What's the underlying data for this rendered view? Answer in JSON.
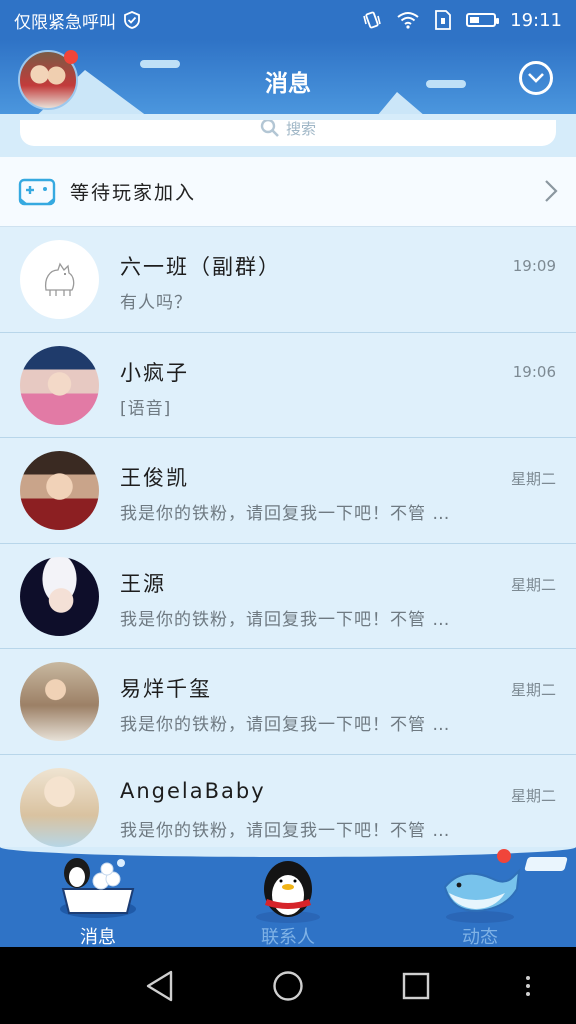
{
  "status_bar": {
    "carrier_text": "仅限紧急呼叫",
    "time": "19:11"
  },
  "header": {
    "title": "消息"
  },
  "search": {
    "placeholder": "搜索"
  },
  "game_row": {
    "label": "等待玩家加入"
  },
  "chats": [
    {
      "name": "六一班（副群）",
      "time": "19:09",
      "preview": "有人吗？",
      "avatar": "cat"
    },
    {
      "name": "小疯子",
      "time": "19:06",
      "preview": "[语音]",
      "avatar": "girl-hat"
    },
    {
      "name": "王俊凯",
      "time": "星期二",
      "preview": "我是你的铁粉，请回复我一下吧！不管 …",
      "avatar": "boy-red"
    },
    {
      "name": "王源",
      "time": "星期二",
      "preview": "我是你的铁粉，请回复我一下吧！不管 …",
      "avatar": "boy-white-hat"
    },
    {
      "name": "易烊千玺",
      "time": "星期二",
      "preview": "我是你的铁粉，请回复我一下吧！不管 …",
      "avatar": "boy-book"
    },
    {
      "name": "AngelaBaby",
      "time": "星期二",
      "preview": "我是你的铁粉，请回复我一下吧！不管 …",
      "avatar": "girl-face"
    }
  ],
  "tabs": [
    {
      "label": "消息",
      "active": true,
      "icon": "penguin-bath-icon"
    },
    {
      "label": "联系人",
      "active": false,
      "icon": "penguin-icon"
    },
    {
      "label": "动态",
      "active": false,
      "icon": "whale-icon"
    }
  ],
  "colors": {
    "accent": "#2f73c6",
    "list_bg": "#dff0fb",
    "badge": "#f0453a",
    "tab_active": "#ffffff",
    "tab_inactive": "#7fb2e6"
  }
}
